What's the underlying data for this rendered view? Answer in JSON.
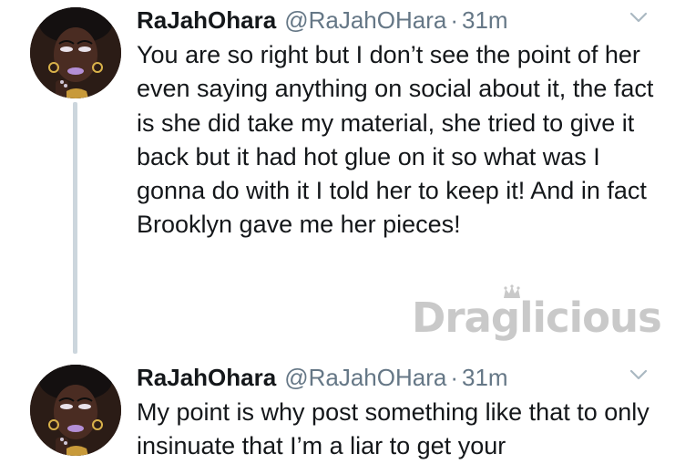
{
  "thread": {
    "tweets": [
      {
        "display_name": "RaJahOhara",
        "handle": "@RaJahOHara",
        "separator": "·",
        "time": "31m",
        "text": "You are so right but I don’t see the point of her even saying anything on social about it, the fact is she did take my material, she tried to give it back but it had hot glue on it so what was I gonna do with it I told her to keep it! And in fact Brooklyn gave me her pieces!",
        "menu_icon": "chevron-down-icon",
        "avatar_icon": "avatar"
      },
      {
        "display_name": "RaJahOhara",
        "handle": "@RaJahOHara",
        "separator": "·",
        "time": "31m",
        "text": "My point is why post something like that to only insinuate that I’m a liar to get your",
        "menu_icon": "chevron-down-icon",
        "avatar_icon": "avatar"
      }
    ]
  },
  "watermark": {
    "text": "Draglicious"
  },
  "colors": {
    "text_primary": "#14171a",
    "text_secondary": "#657786",
    "thread_line": "#ccd6dd",
    "watermark": "#c9c9c9",
    "background": "#ffffff"
  }
}
